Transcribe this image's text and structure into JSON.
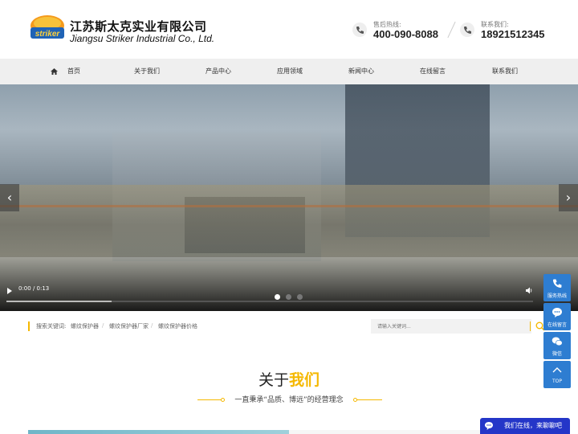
{
  "header": {
    "logo_text": "striker",
    "company_cn": "江苏斯太克实业有限公司",
    "company_en": "Jiangsu Striker Industrial Co., Ltd.",
    "hotline_label": "售后热线:",
    "hotline_number": "400-090-8088",
    "contact_label": "联系我们:",
    "contact_number": "18921512345"
  },
  "nav": {
    "items": [
      {
        "label": "首页",
        "icon": "home-icon"
      },
      {
        "label": "关于我们"
      },
      {
        "label": "产品中心"
      },
      {
        "label": "应用领域"
      },
      {
        "label": "新闻中心"
      },
      {
        "label": "在线留言"
      },
      {
        "label": "联系我们"
      }
    ]
  },
  "banner": {
    "prev": "‹",
    "next": "›",
    "video_time": "0:00 / 0:13",
    "progress": 0.2,
    "slide_count": 3,
    "active_slide": 1
  },
  "search": {
    "label": "搜索关键词:",
    "keywords": [
      "螺纹保护器",
      "螺纹保护器厂家",
      "螺纹保护器价格"
    ],
    "placeholder": "请输入关键词..."
  },
  "about": {
    "title_plain": "关于",
    "title_highlight": "我们",
    "subtitle": "一直秉承“品质、博远”的经营理念"
  },
  "sidebar": {
    "items": [
      {
        "label": "服务热线",
        "icon": "phone-icon"
      },
      {
        "label": "在线留言",
        "icon": "chat-icon"
      },
      {
        "label": "微信",
        "icon": "wechat-icon"
      },
      {
        "label": "TOP",
        "icon": "chevron-up-icon"
      }
    ]
  },
  "chat": {
    "label": "我们在线，来聊聊吧"
  },
  "colors": {
    "accent": "#f5b800",
    "side_blue": "#2e7dd1",
    "chat_blue": "#2436c8"
  }
}
